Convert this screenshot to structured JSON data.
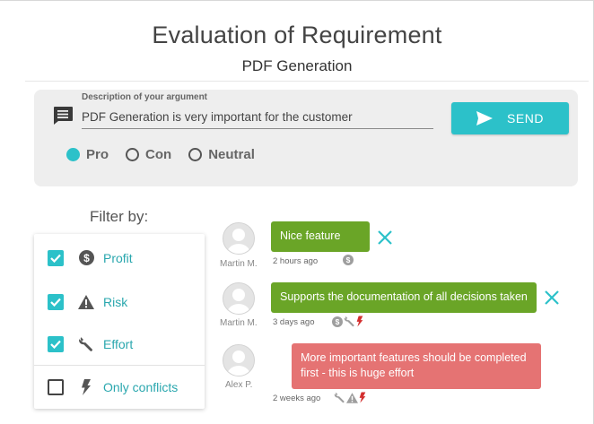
{
  "header": {
    "title": "Evaluation of Requirement",
    "subtitle": "PDF Generation"
  },
  "argument_form": {
    "description_label": "Description of your argument",
    "description_value": "PDF Generation is very important for the customer",
    "send_label": "SEND",
    "options": [
      {
        "label": "Pro",
        "selected": true
      },
      {
        "label": "Con",
        "selected": false
      },
      {
        "label": "Neutral",
        "selected": false
      }
    ]
  },
  "filter": {
    "title": "Filter by:",
    "items": [
      {
        "label": "Profit",
        "checked": true,
        "icon": "dollar-icon"
      },
      {
        "label": "Risk",
        "checked": true,
        "icon": "warning-icon"
      },
      {
        "label": "Effort",
        "checked": true,
        "icon": "wrench-icon"
      },
      {
        "label": "Only conflicts",
        "checked": false,
        "icon": "lightning-icon"
      }
    ]
  },
  "arguments": [
    {
      "author": "Martin M.",
      "text": "Nice feature",
      "time": "2 hours ago",
      "type": "pro",
      "tags": [
        "dollar-icon"
      ],
      "removable": true
    },
    {
      "author": "Martin M.",
      "text": "Supports the documentation of all decisions taken",
      "time": "3 days ago",
      "type": "pro",
      "tags": [
        "dollar-icon",
        "wrench-icon",
        "lightning-icon"
      ],
      "removable": true
    },
    {
      "author": "Alex P.",
      "text": "More important features should be completed first - this is huge effort",
      "time": "2 weeks ago",
      "type": "con",
      "tags": [
        "wrench-icon",
        "warning-icon",
        "lightning-icon"
      ],
      "removable": false
    }
  ],
  "colors": {
    "accent": "#2cc1c9",
    "pro": "#6aa527",
    "con": "#e57373",
    "conflict": "#d32f2f",
    "panel": "#eeeeee"
  }
}
